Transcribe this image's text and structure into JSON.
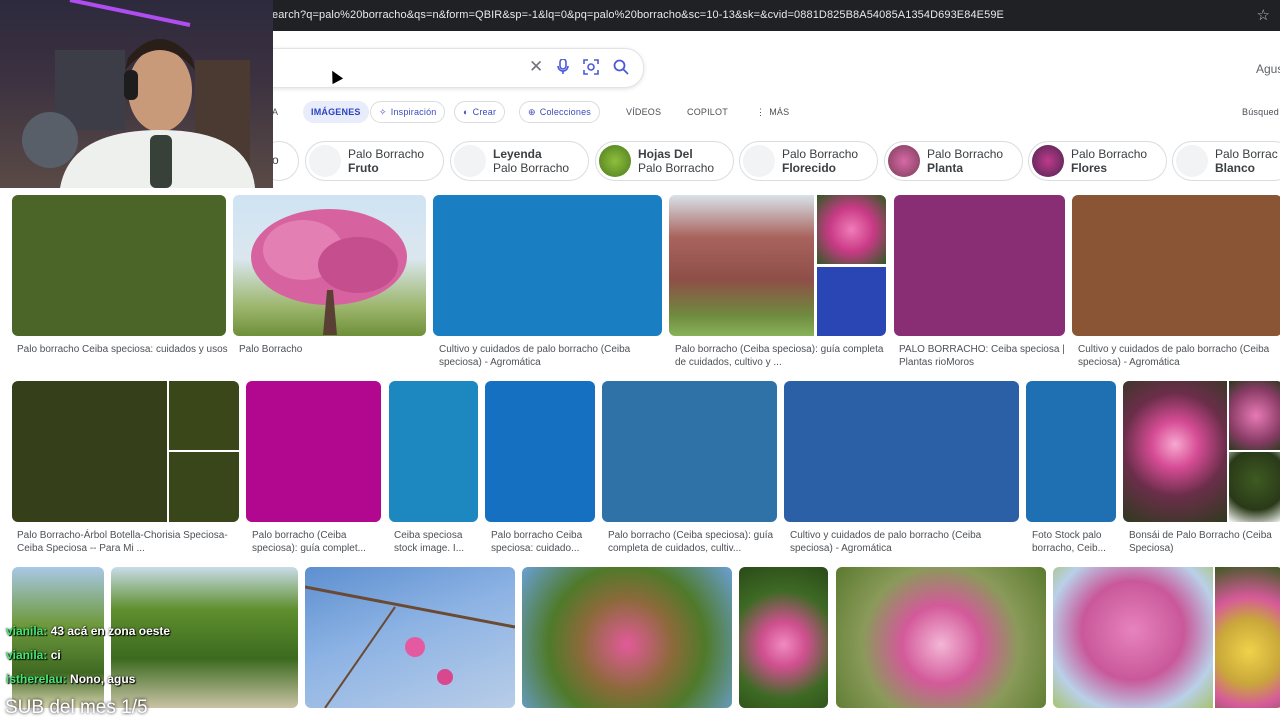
{
  "browser": {
    "url": "earch?q=palo%20borracho&qs=n&form=QBIR&sp=-1&lq=0&pq=palo%20borracho&sc=10-13&sk=&cvid=0881D825B8A54085A1354D693E84E59E",
    "bookmark_icon": "star-icon"
  },
  "search": {
    "clear_icon": "close-icon",
    "mic_icon": "microphone-icon",
    "visual_icon": "camera-icon",
    "search_icon": "search-icon"
  },
  "user_label": "Agus",
  "tabs": {
    "first": "A",
    "images": "IMÁGENES",
    "inspiracion": "Inspiración",
    "crear": "Crear",
    "colecciones": "Colecciones",
    "videos": "VÍDEOS",
    "copilot": "COPILOT",
    "mas": "MÁS",
    "busquedas": "Búsqued"
  },
  "chips": [
    {
      "line1": "o",
      "line2": ""
    },
    {
      "line1": "Palo Borracho",
      "line2": "Fruto"
    },
    {
      "line1": "Leyenda",
      "line2": "Palo Borracho"
    },
    {
      "line1": "Hojas Del",
      "line2": "Palo Borracho"
    },
    {
      "line1": "Palo Borracho",
      "line2": "Florecido"
    },
    {
      "line1": "Palo Borracho",
      "line2": "Planta"
    },
    {
      "line1": "Palo Borracho",
      "line2": "Flores"
    },
    {
      "line1": "Palo Borrac",
      "line2": "Blanco"
    }
  ],
  "results_row1": [
    {
      "caption": "Palo borracho Ceiba speciosa: cuidados y usos",
      "color": "#4b6427"
    },
    {
      "caption": "Palo Borracho",
      "color": "#c85a98"
    },
    {
      "caption": "Cultivo y cuidados de palo borracho (Ceiba speciosa) - Agromática",
      "color": "#1a7fc2"
    },
    {
      "caption": "Palo borracho (Ceiba speciosa): guía completa de cuidados, cultivo y ...",
      "color": "#8a5a54"
    },
    {
      "caption": "PALO BORRACHO: Ceiba speciosa | Plantas rioMoros",
      "color": "#892d74"
    },
    {
      "caption": "Cultivo y cuidados de palo borracho (Ceiba speciosa) - Agromática",
      "color": "#8a5534"
    }
  ],
  "results_row2": [
    {
      "caption": "Palo Borracho-Árbol Botella-Chorisia Speciosa-Ceiba Speciosa -- Para Mi ...",
      "color": "#35401a"
    },
    {
      "caption": "Palo borracho (Ceiba speciosa): guía complet...",
      "color": "#b2088f"
    },
    {
      "caption": "Ceiba speciosa stock image. I...",
      "color": "#1d87c0"
    },
    {
      "caption": "Palo borracho Ceiba speciosa: cuidado...",
      "color": "#1570c2"
    },
    {
      "caption": "Palo borracho (Ceiba speciosa): guía completa de cuidados, cultiv...",
      "color": "#2f72a8"
    },
    {
      "caption": "Cultivo y cuidados de palo borracho (Ceiba speciosa) - Agromática",
      "color": "#2b5fa6"
    },
    {
      "caption": "Foto Stock palo borracho, Ceib...",
      "color": "#1f70b3"
    },
    {
      "caption": "Bonsái de Palo Borracho (Ceiba Speciosa)",
      "color": "#6b2e4a"
    }
  ],
  "chat": [
    {
      "user": "vianila:",
      "text": "43 acá en zona oeste"
    },
    {
      "user": "vianila:",
      "text": "ci"
    },
    {
      "user": "isthereIau:",
      "text": "Nono, agus"
    }
  ],
  "overlay_text": "SUB del mes 1/5"
}
